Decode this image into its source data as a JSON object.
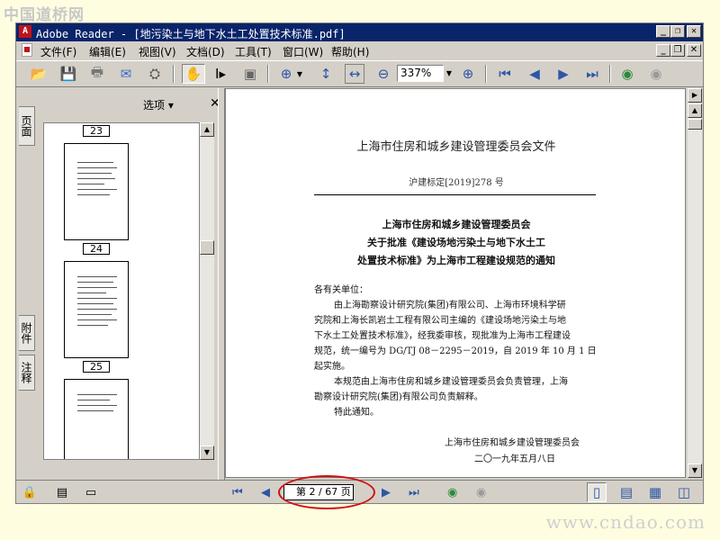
{
  "site": {
    "logo": "中国道桥网",
    "footer": "www.cndao.com"
  },
  "window": {
    "title": "Adobe Reader - [地污染土与地下水土工处置技术标准.pdf]"
  },
  "menu": [
    "文件(F)",
    "编辑(E)",
    "视图(V)",
    "文档(D)",
    "工具(T)",
    "窗口(W)",
    "帮助(H)"
  ],
  "toolbar": {
    "zoom": "337%"
  },
  "panel": {
    "options_label": "选项 ▾",
    "close": "✕",
    "tabs": [
      "页面",
      "附件",
      "注释"
    ]
  },
  "thumbnails": [
    "23",
    "24",
    "25"
  ],
  "document": {
    "header": "上海市住房和城乡建设管理委员会文件",
    "doc_number": "沪建标定[2019]278 号",
    "title_lines": [
      "上海市住房和城乡建设管理委员会",
      "关于批准《建设场地污染土与地下水土工",
      "处置技术标准》为上海市工程建设规范的通知"
    ],
    "salutation": "各有关单位：",
    "body_lines": [
      "由上海勘察设计研究院(集团)有限公司、上海市环境科学研",
      "究院和上海长凯岩土工程有限公司主编的《建设场地污染土与地",
      "下水土工处置技术标准》，经我委审核，现批准为上海市工程建设",
      "规范，统一编号为 DG/TJ 08－2295－2019，自 2019 年 10 月 1 日",
      "起实施。",
      "本规范由上海市住房和城乡建设管理委员会负责管理，上海",
      "勘察设计研究院(集团)有限公司负责解释。",
      "特此通知。"
    ],
    "signature": "上海市住房和城乡建设管理委员会",
    "date": "二〇一九年五月八日"
  },
  "statusbar": {
    "page_indicator": "第 2 / 67 页"
  },
  "colors": {
    "titlebar": "#0a246a",
    "highlight_ellipse": "#d01010"
  }
}
